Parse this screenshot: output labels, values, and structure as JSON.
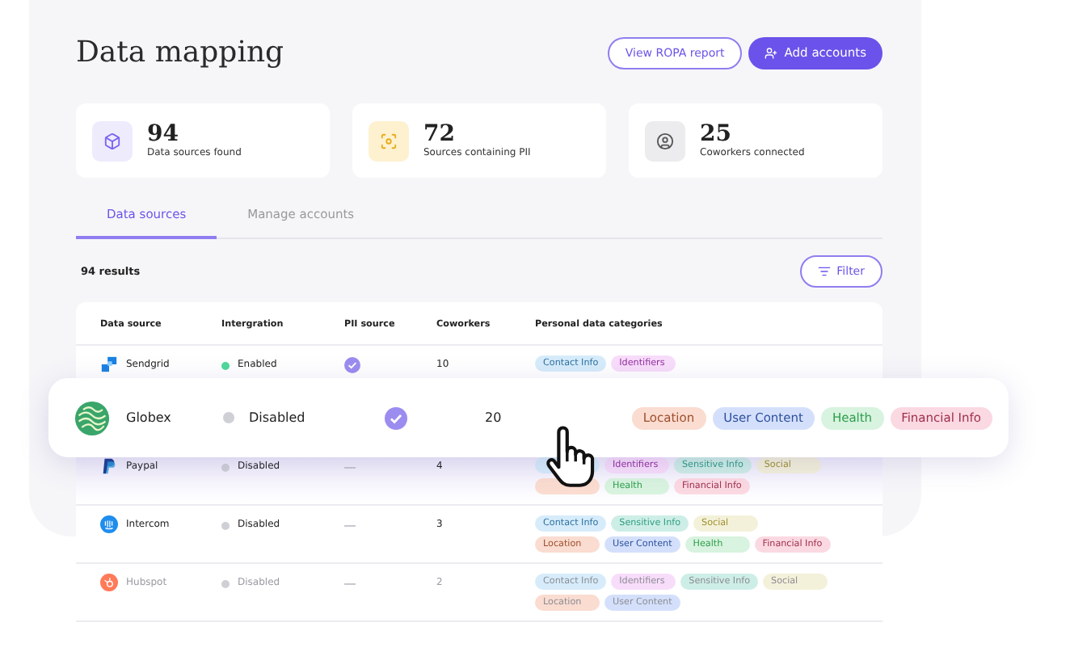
{
  "title": "Data mapping",
  "buttons": {
    "report": "View ROPA report",
    "add": "Add accounts"
  },
  "stats": [
    {
      "kind": "cube",
      "value": "94",
      "label": "Data sources found"
    },
    {
      "kind": "focus",
      "value": "72",
      "label": "Sources containing PII"
    },
    {
      "kind": "user",
      "value": "25",
      "label": "Coworkers connected"
    }
  ],
  "tabs": [
    {
      "label": "Data sources",
      "selected": true
    },
    {
      "label": "Manage accounts",
      "selected": false
    }
  ],
  "results": "94 results",
  "filter": "Filter",
  "table": {
    "columns": [
      "Data source",
      "Intergration",
      "PII source",
      "Coworkers",
      "Personal data categories"
    ],
    "rows": [
      {
        "kind": "squares",
        "name": "Sendgrid",
        "enabled": true,
        "status": "Enabled",
        "pii": true,
        "coworkers": "10",
        "faded": false,
        "tags": [
          [
            {
              "text": "Contact Info",
              "color": "#d6ecfb"
            },
            {
              "text": "Identifiers",
              "color": "#f8ddfb"
            }
          ]
        ]
      },
      {
        "kind": "pshape",
        "name": "Paypal",
        "enabled": false,
        "status": "Disabled",
        "pii": false,
        "coworkers": "4",
        "faded": false,
        "tags": [
          [
            {
              "color": "#d6ecfb"
            },
            {
              "text": "Identifiers",
              "color": "#f8ddfb"
            },
            {
              "text": "Sensitive Info",
              "color": "#cdeee6"
            },
            {
              "text": "Social",
              "color": "#f4f1da"
            }
          ],
          [
            {
              "color": "#fadcd0"
            },
            {
              "text": "Health",
              "color": "#d8f3df"
            },
            {
              "text": "Financial Info",
              "color": "#fbd9e2"
            }
          ]
        ]
      },
      {
        "kind": "bars",
        "name": "Intercom",
        "enabled": false,
        "status": "Disabled",
        "pii": false,
        "coworkers": "3",
        "faded": false,
        "tags": [
          [
            {
              "text": "Contact Info",
              "color": "#d6ecfb"
            },
            {
              "text": "Sensitive Info",
              "color": "#cdeee6"
            },
            {
              "text": "Social",
              "color": "#f4f1da"
            }
          ],
          [
            {
              "text": "Location",
              "color": "#fadcd0"
            },
            {
              "text": "User Content",
              "color": "#d4e0fb"
            },
            {
              "text": "Health",
              "color": "#d8f3df"
            },
            {
              "text": "Financial Info",
              "color": "#fbd9e2"
            }
          ]
        ]
      },
      {
        "kind": "sprocket",
        "name": "Hubspot",
        "enabled": false,
        "status": "Disabled",
        "pii": false,
        "coworkers": "2",
        "faded": true,
        "tags": [
          [
            {
              "text": "Contact Info",
              "color": "#d6ecfb"
            },
            {
              "text": "Identifiers",
              "color": "#f8ddfb"
            },
            {
              "text": "Sensitive Info",
              "color": "#cdeee6"
            },
            {
              "text": "Social",
              "color": "#f4f1da"
            }
          ],
          [
            {
              "text": "Location",
              "color": "#fadcd0"
            },
            {
              "text": "User Content",
              "color": "#d4e0fb"
            }
          ]
        ]
      }
    ]
  },
  "highlight": {
    "kind": "waves",
    "name": "Globex",
    "enabled": false,
    "status": "Disabled",
    "pii": true,
    "coworkers": "20",
    "tags": [
      {
        "text": "Location",
        "color": "#fadcd0"
      },
      {
        "text": "User Content",
        "color": "#d4e0fb"
      },
      {
        "text": "Health",
        "color": "#d8f3df"
      },
      {
        "text": "Financial Info",
        "color": "#fbd9e2"
      }
    ]
  }
}
